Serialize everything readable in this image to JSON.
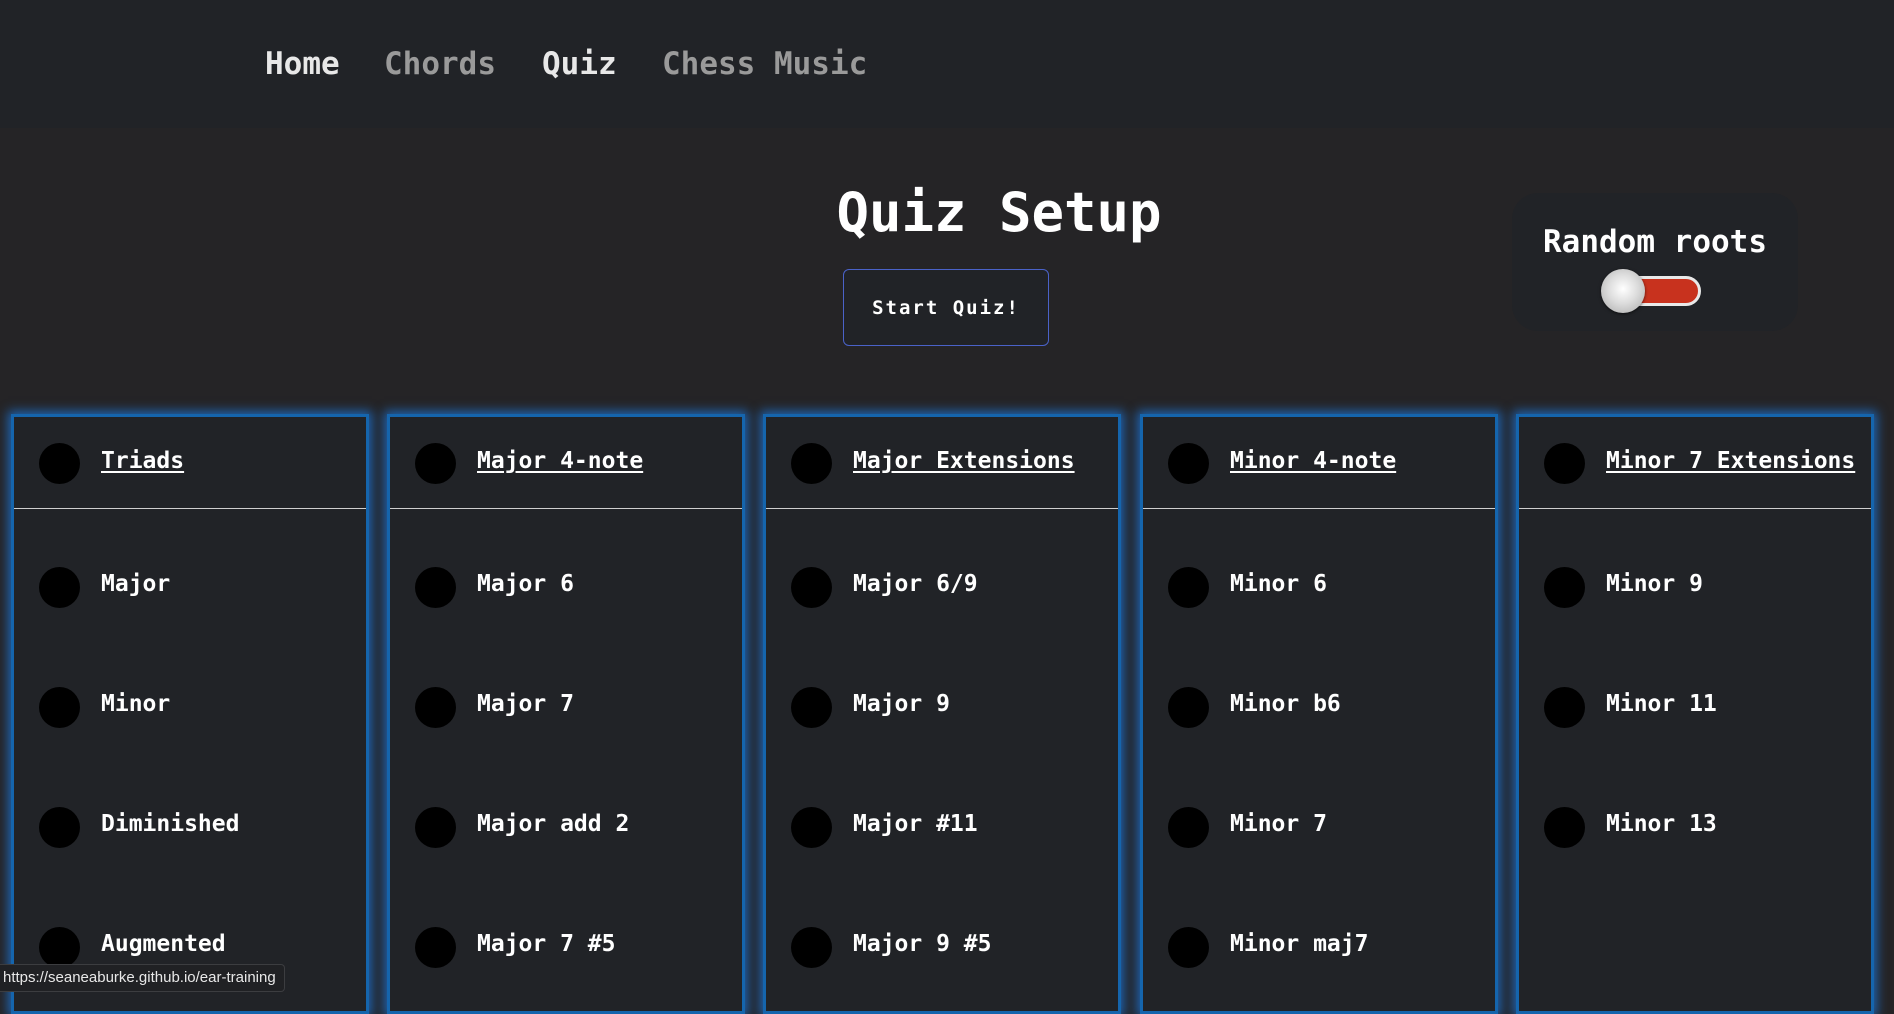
{
  "nav": {
    "home": "Home",
    "chords": "Chords",
    "quiz": "Quiz",
    "chess_music": "Chess Music"
  },
  "main": {
    "title": "Quiz Setup",
    "start_button": "Start Quiz!"
  },
  "random_roots": {
    "label": "Random roots",
    "enabled": false
  },
  "groups": [
    {
      "title": "Triads",
      "options": [
        "Major",
        "Minor",
        "Diminished",
        "Augmented"
      ]
    },
    {
      "title": "Major 4-note",
      "options": [
        "Major 6",
        "Major 7",
        "Major add 2",
        "Major 7 #5"
      ]
    },
    {
      "title": "Major Extensions",
      "options": [
        "Major 6/9",
        "Major 9",
        "Major #11",
        "Major 9 #5"
      ]
    },
    {
      "title": "Minor 4-note",
      "options": [
        "Minor 6",
        "Minor b6",
        "Minor 7",
        "Minor maj7"
      ]
    },
    {
      "title": "Minor 7 Extensions",
      "options": [
        "Minor 9",
        "Minor 11",
        "Minor 13"
      ]
    }
  ],
  "status_bar": {
    "url": "https://seaneaburke.github.io/ear-training"
  },
  "colors": {
    "page_background": "#252426",
    "panel_background": "#212327",
    "card_glow": "#1565ad",
    "toggle_track": "#c8321e",
    "button_border": "#4a62c8"
  }
}
